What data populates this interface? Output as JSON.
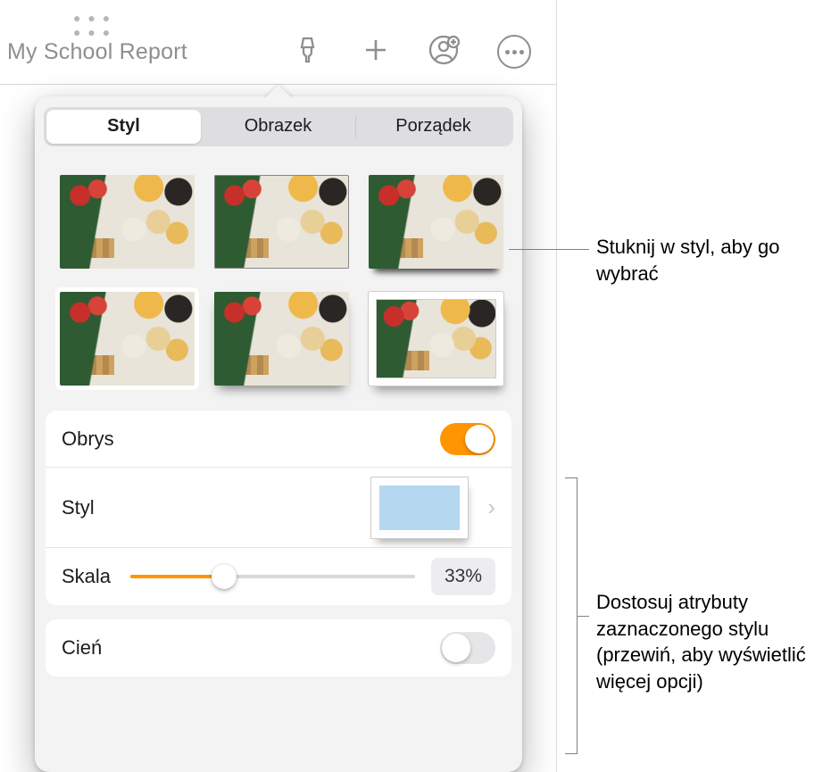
{
  "document_title": "My School Report",
  "tabs": {
    "style": "Styl",
    "image": "Obrazek",
    "arrange": "Porządek"
  },
  "style_presets": [
    "plain",
    "thin-border",
    "reflection",
    "white-mat",
    "soft-shadow",
    "thick-white-shadow"
  ],
  "options": {
    "outline": {
      "label": "Obrys",
      "enabled": true
    },
    "style_row": {
      "label": "Styl"
    },
    "scale": {
      "label": "Skala",
      "percent": 33,
      "display": "33%"
    },
    "shadow": {
      "label": "Cień",
      "enabled": false
    }
  },
  "callouts": {
    "pick_style": "Stuknij w styl, aby go wybrać",
    "adjust_attrs": "Dostosuj atrybuty zaznaczonego stylu (przewiń, aby wyświetlić więcej opcji)"
  },
  "icons": {
    "format": "format-brush-icon",
    "add": "plus-icon",
    "collaborate": "collaborate-icon",
    "more": "more-icon"
  }
}
